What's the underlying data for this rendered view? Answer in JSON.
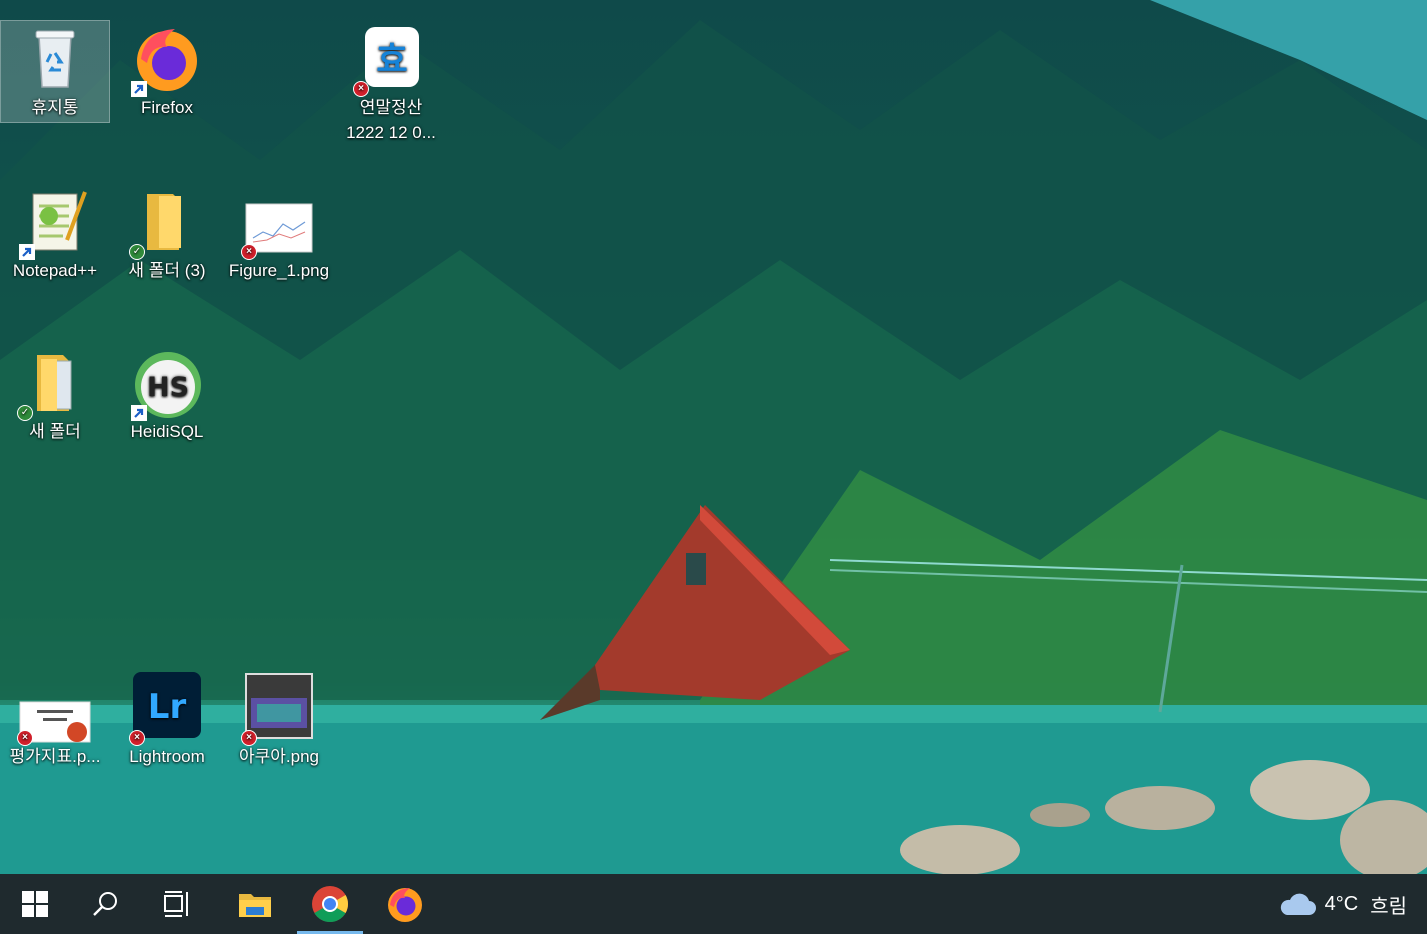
{
  "desktop": {
    "icons": [
      {
        "label": "휴지통",
        "name": "recycle-bin-icon"
      },
      {
        "label": "Firefox",
        "name": "firefox-icon"
      },
      {
        "label": "연말정산 1222 12 0...",
        "name": "hometax-doc-icon",
        "icon_text": "효"
      },
      {
        "label": "Notepad++",
        "name": "notepad-plus-plus-icon"
      },
      {
        "label": "새 폴더 (3)",
        "name": "folder-icon"
      },
      {
        "label": "Figure_1.png",
        "name": "image-thumbnail-icon"
      },
      {
        "label": "새 폴더",
        "name": "folder-icon"
      },
      {
        "label": "HeidiSQL",
        "name": "heidisql-icon",
        "icon_text": "HS"
      },
      {
        "label": "평가지표.p...",
        "name": "powerpoint-file-icon"
      },
      {
        "label": "Lightroom",
        "name": "lightroom-icon",
        "icon_text": "Lr"
      },
      {
        "label": "아쿠아.png",
        "name": "image-thumbnail-icon"
      }
    ]
  },
  "taskbar": {
    "buttons": [
      {
        "name": "start-button",
        "icon": "windows-logo-icon"
      },
      {
        "name": "search-button",
        "icon": "search-icon"
      },
      {
        "name": "task-view-button",
        "icon": "task-view-icon"
      },
      {
        "name": "file-explorer-button",
        "icon": "folder-icon"
      },
      {
        "name": "chrome-button",
        "icon": "chrome-icon",
        "active": true
      },
      {
        "name": "firefox-button",
        "icon": "firefox-icon"
      }
    ],
    "weather": {
      "temp": "4°C",
      "condition": "흐림",
      "icon": "cloud-icon"
    }
  },
  "colors": {
    "taskbar": "#1f2a2e",
    "active_indicator": "#76b9ed",
    "error_badge": "#d1202b",
    "sync_badge": "#2f8a3a"
  }
}
